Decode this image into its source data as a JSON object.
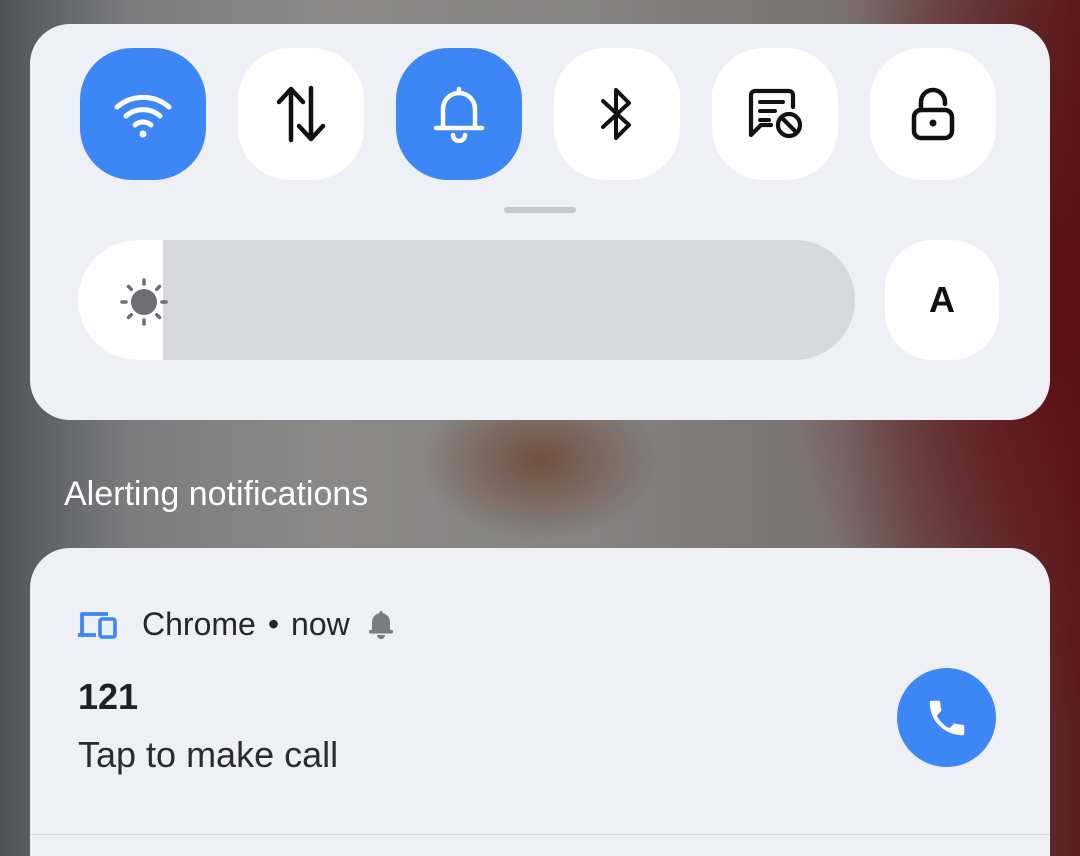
{
  "quick_settings": {
    "tiles": [
      {
        "name": "wifi",
        "icon": "wifi-icon",
        "active": true
      },
      {
        "name": "mobile-data",
        "icon": "data-arrows-icon",
        "active": false
      },
      {
        "name": "sound",
        "icon": "bell-icon",
        "active": true
      },
      {
        "name": "bluetooth",
        "icon": "bluetooth-icon",
        "active": false
      },
      {
        "name": "do-not-disturb",
        "icon": "message-block-icon",
        "active": false
      },
      {
        "name": "screen-lock",
        "icon": "lock-open-icon",
        "active": false
      }
    ],
    "brightness": {
      "level": 0.11,
      "icon": "sun-icon",
      "auto_label": "A"
    },
    "colors": {
      "panel_bg": "#eff0f5",
      "active_tile": "#3d86f6",
      "inactive_tile": "#ffffff"
    }
  },
  "section_header": "Alerting notifications",
  "notification": {
    "app_name": "Chrome",
    "separator": "•",
    "time": "now",
    "app_icon": "devices-icon",
    "bell_icon": "bell-small-icon",
    "title": "121",
    "text": "Tap to make call",
    "action_icon": "phone-icon",
    "action_color": "#3d86f6"
  }
}
